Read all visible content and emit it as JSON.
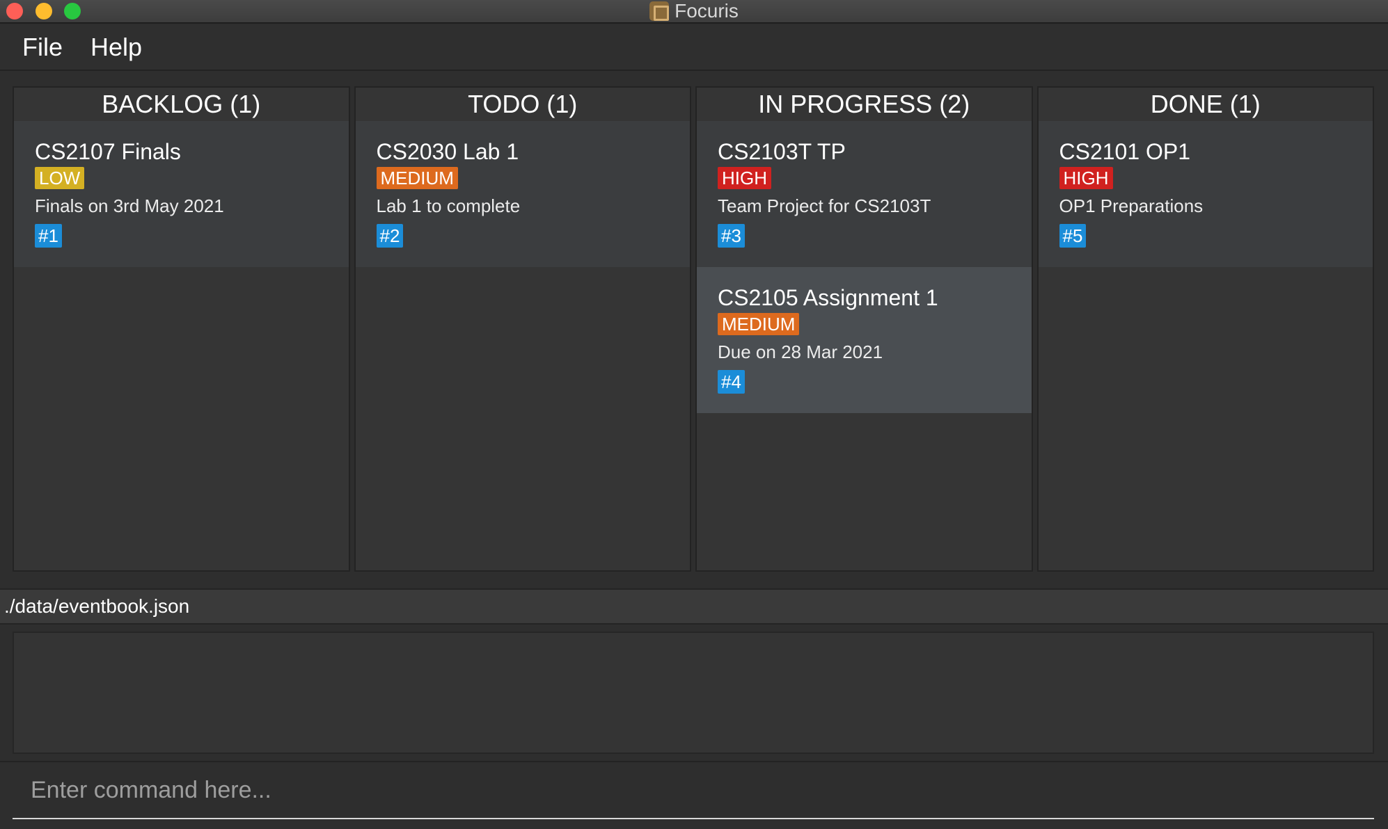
{
  "window": {
    "title": "Focuris"
  },
  "menu": {
    "file": "File",
    "help": "Help"
  },
  "columns": [
    {
      "header": "BACKLOG (1)",
      "cards": [
        {
          "title": "CS2107 Finals",
          "priority": "LOW",
          "priority_color": "#d4b023",
          "description": "Finals on 3rd May 2021",
          "id": "#1"
        }
      ]
    },
    {
      "header": "TODO (1)",
      "cards": [
        {
          "title": "CS2030 Lab 1",
          "priority": "MEDIUM",
          "priority_color": "#dd6a1e",
          "description": "Lab 1 to complete",
          "id": "#2"
        }
      ]
    },
    {
      "header": "IN PROGRESS (2)",
      "cards": [
        {
          "title": "CS2103T TP",
          "priority": "HIGH",
          "priority_color": "#d0211f",
          "description": "Team Project for CS2103T",
          "id": "#3"
        },
        {
          "title": "CS2105 Assignment 1",
          "priority": "MEDIUM",
          "priority_color": "#dd6a1e",
          "description": "Due on 28 Mar 2021",
          "id": "#4"
        }
      ]
    },
    {
      "header": "DONE (1)",
      "cards": [
        {
          "title": "CS2101 OP1",
          "priority": "HIGH",
          "priority_color": "#d0211f",
          "description": "OP1 Preparations",
          "id": "#5"
        }
      ]
    }
  ],
  "status": {
    "file_path": "./data/eventbook.json"
  },
  "result": {
    "text": ""
  },
  "command": {
    "placeholder": "Enter command here...",
    "value": ""
  }
}
